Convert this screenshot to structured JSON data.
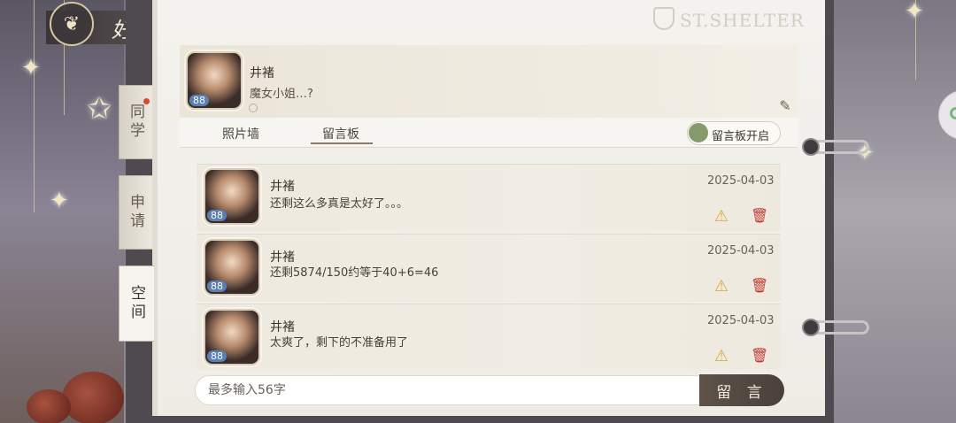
{
  "header": {
    "title": "好友",
    "emblem_icon": "butterfly-icon"
  },
  "brand": {
    "text": "ST.SHELTER"
  },
  "side_tabs": [
    {
      "label": "同学",
      "active": false,
      "has_notification": true
    },
    {
      "label": "申请",
      "active": false,
      "has_notification": false
    },
    {
      "label": "空间",
      "active": true,
      "has_notification": false
    }
  ],
  "profile": {
    "name": "井褚",
    "signature": "魔女小姐…?",
    "level": "88"
  },
  "tabs": [
    {
      "label": "照片墙",
      "active": false
    },
    {
      "label": "留言板",
      "active": true
    }
  ],
  "toggle": {
    "label": "留言板开启",
    "on": true,
    "color": "#879a6e"
  },
  "messages": [
    {
      "name": "井褚",
      "text": "还剩这么多真是太好了。。。",
      "date": "2025-04-03",
      "level": "88"
    },
    {
      "name": "井褚",
      "text": "还剩5874/150约等于40+6=46",
      "date": "2025-04-03",
      "level": "88"
    },
    {
      "name": "井褚",
      "text": "太爽了，剩下的不准备用了",
      "date": "2025-04-03",
      "level": "88"
    }
  ],
  "input": {
    "placeholder": "最多输入56字",
    "value": ""
  },
  "send_button": {
    "label": "留 言"
  },
  "colors": {
    "accent": "#4a403a",
    "warn": "#d6a73a",
    "delete": "#c23a32"
  }
}
